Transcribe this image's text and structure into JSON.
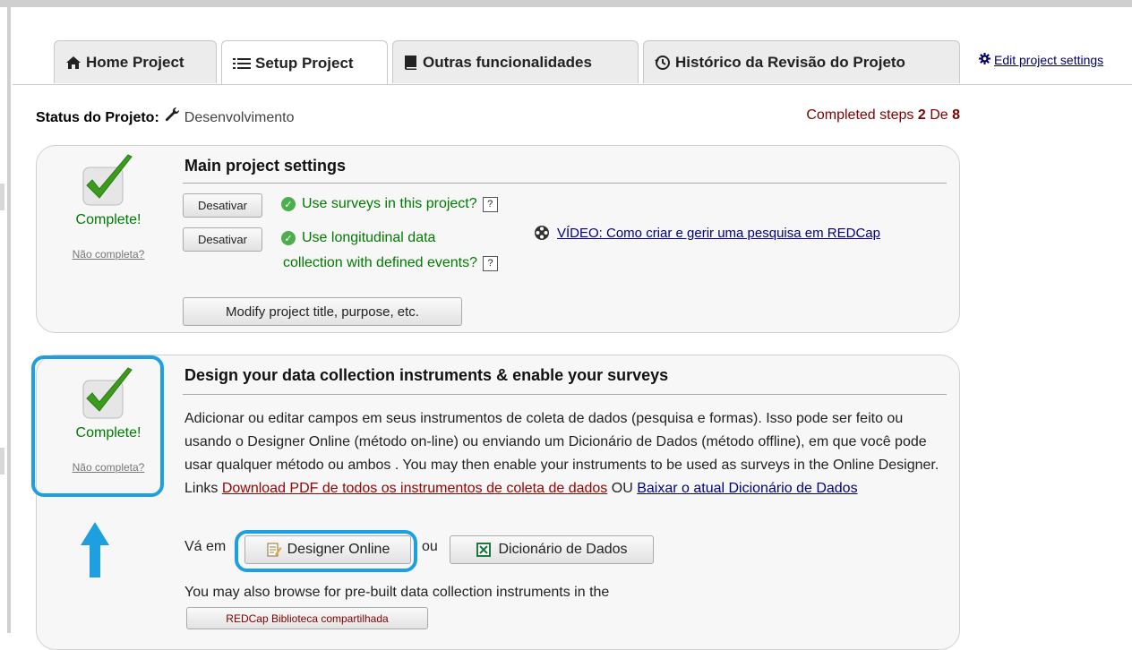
{
  "tabs": [
    {
      "label": "Home Project",
      "icon": "home-icon"
    },
    {
      "label": "Setup Project",
      "icon": "list-icon"
    },
    {
      "label": "Outras funcionalidades",
      "icon": "book-icon"
    },
    {
      "label": "Histórico da Revisão do Projeto",
      "icon": "history-icon"
    }
  ],
  "edit_settings": "Edit project settings",
  "status": {
    "label": "Status do Projeto:",
    "value": "Desenvolvimento",
    "steps_prefix": "Completed steps",
    "steps_done": "2",
    "steps_sep": "De",
    "steps_total": "8"
  },
  "panel1": {
    "complete": "Complete!",
    "not_complete": "Não completa?",
    "title": "Main project settings",
    "disable1": "Desativar",
    "disable2": "Desativar",
    "opt1": "Use surveys in this project?",
    "opt2_line1": "Use longitudinal data",
    "opt2_line2": "collection with defined events?",
    "qmark": "?",
    "video": "VÍDEO: Como criar e gerir uma pesquisa em REDCap",
    "modify": "Modify project title, purpose, etc."
  },
  "panel2": {
    "complete": "Complete!",
    "not_complete": "Não completa?",
    "title": "Design your data collection instruments & enable your surveys",
    "desc": "Adicionar ou editar campos em seus instrumentos de coleta de dados (pesquisa e formas). Isso pode ser feito ou usando o Designer Online (método on-line) ou enviando um Dicionário de Dados (método offline), em que você pode usar qualquer método ou ambos . You may then enable your instruments to be used as surveys in the Online Designer. Links",
    "link_pdf": "Download PDF de todos os instrumentos de coleta de dados",
    "or": "OU",
    "link_dict": "Baixar o atual Dicionário de Dados",
    "go_to": "Vá em",
    "designer": "Designer Online",
    "ou": "ou",
    "dictionary": "Dicionário de Dados",
    "browse": "You may also browse for pre-built data collection instruments in the",
    "library": "REDCap Biblioteca compartilhada"
  },
  "colors": {
    "accent_highlight": "#1e9fe0",
    "complete_green": "#007a00",
    "steps_red": "#800000"
  }
}
